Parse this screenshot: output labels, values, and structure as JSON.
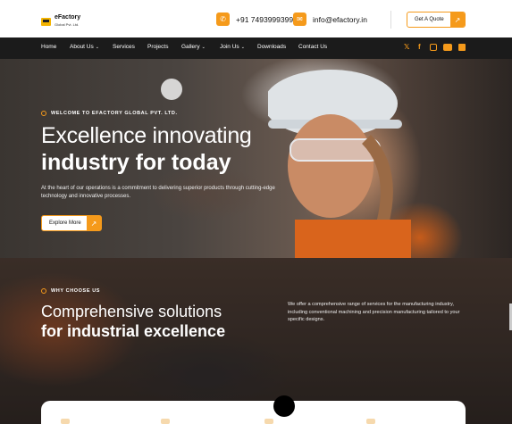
{
  "brand": {
    "name": "eFactory",
    "sub": "Global Pvt. Ltd."
  },
  "header": {
    "phone": "+91 7493999399",
    "email": "info@efactory.in",
    "quote_label": "Get A Quote"
  },
  "nav": {
    "items": [
      {
        "label": "Home",
        "caret": false
      },
      {
        "label": "About Us",
        "caret": true
      },
      {
        "label": "Services",
        "caret": false
      },
      {
        "label": "Projects",
        "caret": false
      },
      {
        "label": "Gallery",
        "caret": true
      },
      {
        "label": "Join Us",
        "caret": true
      },
      {
        "label": "Downloads",
        "caret": false
      },
      {
        "label": "Contact Us",
        "caret": false
      }
    ],
    "social": [
      "x-icon",
      "facebook-icon",
      "instagram-icon",
      "youtube-icon",
      "linkedin-icon"
    ]
  },
  "hero": {
    "eyebrow": "WELCOME TO EFACTORY GLOBAL PVT. LTD.",
    "title_light": "Excellence innovating",
    "title_bold": "industry for today",
    "paragraph": "At the heart of our operations is a commitment to delivering superior products through cutting-edge technology and innovative processes.",
    "button_label": "Explore More"
  },
  "why": {
    "eyebrow": "WHY CHOOSE US",
    "title_light": "Comprehensive solutions",
    "title_bold": "for industrial excellence",
    "paragraph": "We offer a comprehensive range of services for the manufacturing industry, including conventional machining and precision manufacturing tailored to your specific designs."
  },
  "colors": {
    "accent": "#f59a1b",
    "nav_bg": "#1b1b1b"
  }
}
